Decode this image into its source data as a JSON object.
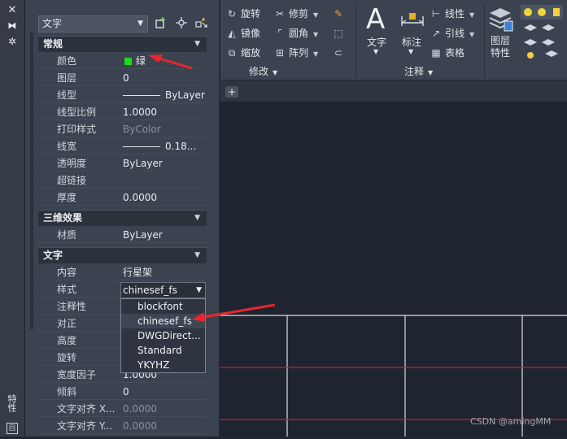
{
  "left_strip": {
    "close_glyph": "✕",
    "pin_glyph": "⧓",
    "gear_glyph": "✲",
    "vertical_label": "特性",
    "bottom_glyph": "回"
  },
  "selector": {
    "value": "文字"
  },
  "sections": {
    "general": {
      "title": "常规"
    },
    "three_d": {
      "title": "三维效果"
    },
    "text": {
      "title": "文字"
    }
  },
  "general_rows": [
    {
      "key": "颜色",
      "value": "绿"
    },
    {
      "key": "图层",
      "value": "0"
    },
    {
      "key": "线型",
      "value": "ByLayer"
    },
    {
      "key": "线型比例",
      "value": "1.0000"
    },
    {
      "key": "打印样式",
      "value": "ByColor"
    },
    {
      "key": "线宽",
      "value": "0.18..."
    },
    {
      "key": "透明度",
      "value": "ByLayer"
    },
    {
      "key": "超链接",
      "value": ""
    },
    {
      "key": "厚度",
      "value": "0.0000"
    }
  ],
  "three_d_rows": [
    {
      "key": "材质",
      "value": "ByLayer"
    }
  ],
  "text_rows": [
    {
      "key": "内容",
      "value": "行星架"
    },
    {
      "key": "样式",
      "value": "chinesef_fs"
    },
    {
      "key": "注释性",
      "value": ""
    },
    {
      "key": "对正",
      "value": ""
    },
    {
      "key": "高度",
      "value": ""
    },
    {
      "key": "旋转",
      "value": ""
    },
    {
      "key": "宽度因子",
      "value": "1.0000"
    },
    {
      "key": "倾斜",
      "value": "0"
    },
    {
      "key": "文字对齐 X...",
      "value": "0.0000"
    },
    {
      "key": "文字对齐 Y...",
      "value": "0.0000"
    }
  ],
  "style_dropdown": {
    "options": [
      "blockfont",
      "chinesef_fs",
      "DWGDirect...",
      "Standard",
      "YKYHZ"
    ],
    "selected_index": 1
  },
  "ribbon": {
    "modify": {
      "title": "修改",
      "buttons": [
        "旋转",
        "修剪",
        "镜像",
        "圆角",
        "缩放",
        "阵列"
      ]
    },
    "annotation": {
      "title": "注释",
      "big_buttons": [
        "文字",
        "标注"
      ],
      "small_buttons": [
        "线性",
        "引线",
        "表格"
      ]
    },
    "layers": {
      "big_button": "图层\n特性"
    }
  },
  "canvas": {
    "tab_plus": "+"
  },
  "watermark": "CSDN @amingMM",
  "colors": {
    "panel_bg": "#3b4350",
    "canvas_bg": "#1f2530",
    "annotation_arrow": "#e8262e",
    "grid_white": "#d9dde2",
    "grid_red": "#c0262c",
    "color_swatch": "#19e019"
  }
}
